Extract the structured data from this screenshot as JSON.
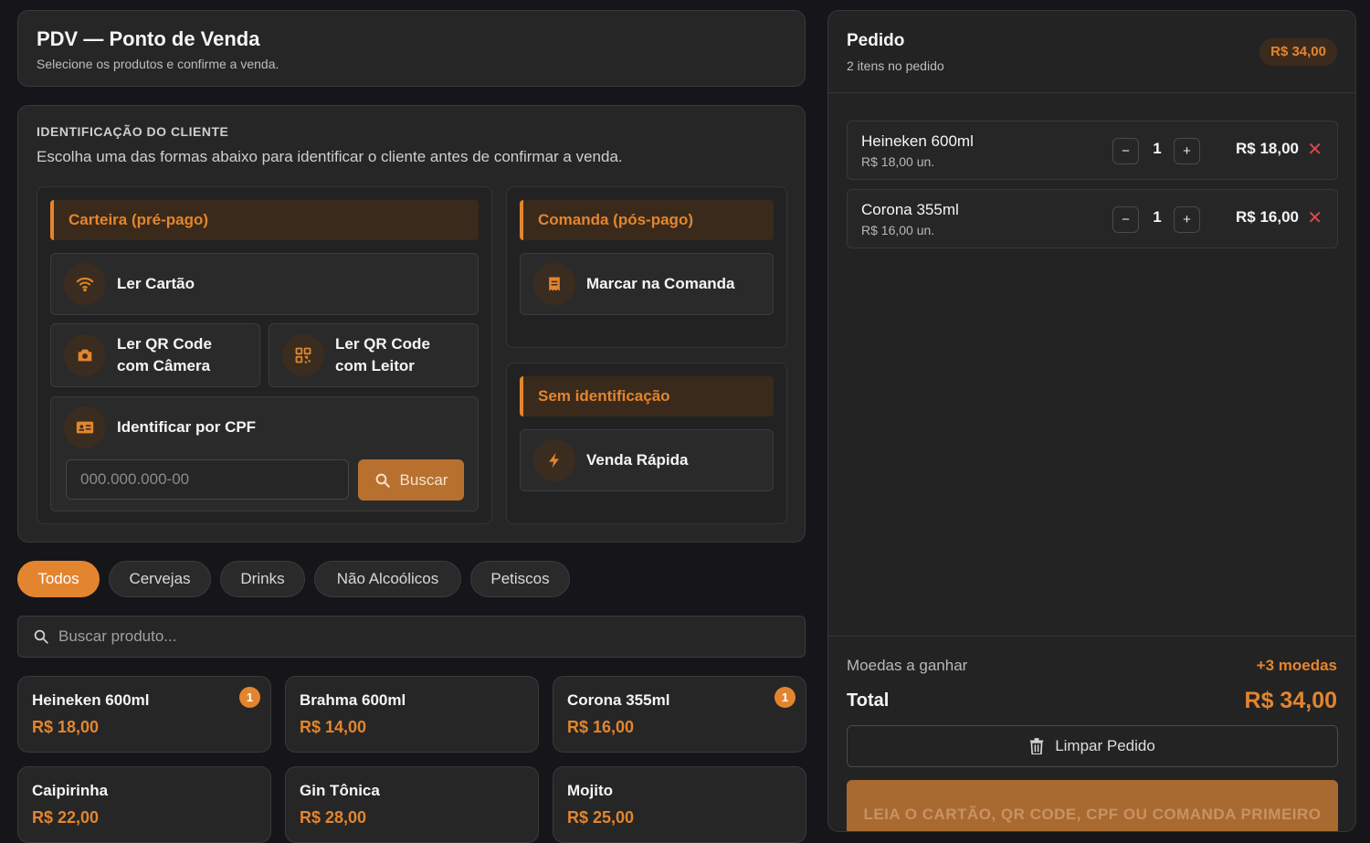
{
  "header": {
    "title": "PDV — Ponto de Venda",
    "subtitle": "Selecione os produtos e confirme a venda."
  },
  "client": {
    "heading": "IDENTIFICAÇÃO DO CLIENTE",
    "description": "Escolha uma das formas abaixo para identificar o cliente antes de confirmar a venda.",
    "wallet": {
      "title": "Carteira (pré-pago)",
      "read_card": "Ler Cartão",
      "qr_camera_l1": "Ler QR Code",
      "qr_camera_l2": "com Câmera",
      "qr_reader_l1": "Ler QR Code",
      "qr_reader_l2": "com Leitor",
      "cpf_label": "Identificar por CPF",
      "cpf_placeholder": "000.000.000-00",
      "search_button": "Buscar"
    },
    "tab_section": {
      "title": "Comanda (pós-pago)",
      "mark": "Marcar na Comanda"
    },
    "no_id": {
      "title": "Sem identificação",
      "quick_sale": "Venda Rápida"
    }
  },
  "categories": [
    "Todos",
    "Cervejas",
    "Drinks",
    "Não Alcoólicos",
    "Petiscos"
  ],
  "active_category": "Todos",
  "product_search": {
    "placeholder": "Buscar produto..."
  },
  "products": [
    {
      "name": "Heineken 600ml",
      "price": "R$ 18,00",
      "badge": "1"
    },
    {
      "name": "Brahma 600ml",
      "price": "R$ 14,00",
      "badge": ""
    },
    {
      "name": "Corona 355ml",
      "price": "R$ 16,00",
      "badge": "1"
    },
    {
      "name": "Caipirinha",
      "price": "R$ 22,00",
      "badge": ""
    },
    {
      "name": "Gin Tônica",
      "price": "R$ 28,00",
      "badge": ""
    },
    {
      "name": "Mojito",
      "price": "R$ 25,00",
      "badge": ""
    }
  ],
  "order": {
    "title": "Pedido",
    "count_text": "2 itens no pedido",
    "total_pill": "R$ 34,00",
    "items": [
      {
        "name": "Heineken 600ml",
        "unit": "R$ 18,00 un.",
        "qty": "1",
        "total": "R$ 18,00"
      },
      {
        "name": "Corona 355ml",
        "unit": "R$ 16,00 un.",
        "qty": "1",
        "total": "R$ 16,00"
      }
    ],
    "coins_label": "Moedas a ganhar",
    "coins_value": "+3 moedas",
    "total_label": "Total",
    "total_value": "R$ 34,00",
    "clear_button": "Limpar Pedido",
    "confirm_button": "LEIA O CARTÃO, QR CODE, CPF OU COMANDA PRIMEIRO"
  },
  "colors": {
    "accent": "#e3852e",
    "background": "#16161a",
    "card": "#262626",
    "danger": "#e04848"
  },
  "icons": {
    "read_card": "wifi-icon",
    "qr_camera": "camera-icon",
    "qr_reader": "qr-icon",
    "cpf": "id-card-icon",
    "tab": "receipt-icon",
    "quick_sale": "lightning-icon",
    "search": "search-icon",
    "clear": "trash-icon",
    "remove": "close-icon"
  }
}
